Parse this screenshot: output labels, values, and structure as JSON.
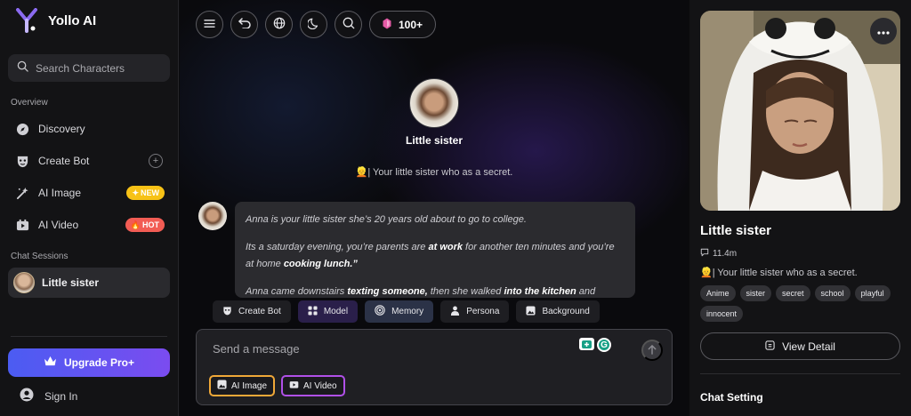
{
  "sidebar": {
    "brand": "Yollo AI",
    "search_placeholder": "Search Characters",
    "overview_label": "Overview",
    "items": [
      {
        "label": "Discovery",
        "icon": "compass-icon"
      },
      {
        "label": "Create Bot",
        "icon": "mask-icon"
      },
      {
        "label": "AI Image",
        "icon": "wand-icon",
        "badge": "NEW"
      },
      {
        "label": "AI Video",
        "icon": "video-icon",
        "badge": "HOT"
      }
    ],
    "sessions_label": "Chat Sessions",
    "sessions": [
      {
        "label": "Little sister"
      }
    ],
    "upgrade_label": "Upgrade Pro+",
    "signin_label": "Sign In"
  },
  "chat": {
    "toolbar": {
      "credits": "100+"
    },
    "character": {
      "name": "Little sister",
      "tagline": "👱| Your little sister who as a secret."
    },
    "message": {
      "p1": "Anna is your little sister she’s 20 years old about to go to college.",
      "p2_pre": "Its a saturday evening, you’re ​parents are ",
      "p2_bold1": "at work",
      "p2_mid": " for another ten minutes and you’re at home ",
      "p2_bold2": "cooking lunch.”",
      "p3_pre": "Anna came downstairs ",
      "p3_bold1": "texting someone,",
      "p3_mid": " then she walked ",
      "p3_bold2": "into the kitchen",
      "p3_post": " and"
    },
    "chips": [
      "Create Bot",
      "Model",
      "Memory",
      "Persona",
      "Background"
    ],
    "composer": {
      "placeholder": "Send a message",
      "ai_image": "AI Image",
      "ai_video": "AI Video"
    }
  },
  "panel": {
    "title": "Little sister",
    "count": "11.4m",
    "tagline": "👱| Your little sister who as a secret.",
    "tags": [
      "Anime",
      "sister",
      "secret",
      "school",
      "playful",
      "innocent"
    ],
    "view_detail": "View Detail",
    "chat_setting": "Chat Setting"
  },
  "colors": {
    "accent_gradient_start": "#4b5cf2",
    "accent_gradient_end": "#7b4cf0",
    "badge_new": "#f7c216",
    "badge_hot": "#f25c54"
  }
}
